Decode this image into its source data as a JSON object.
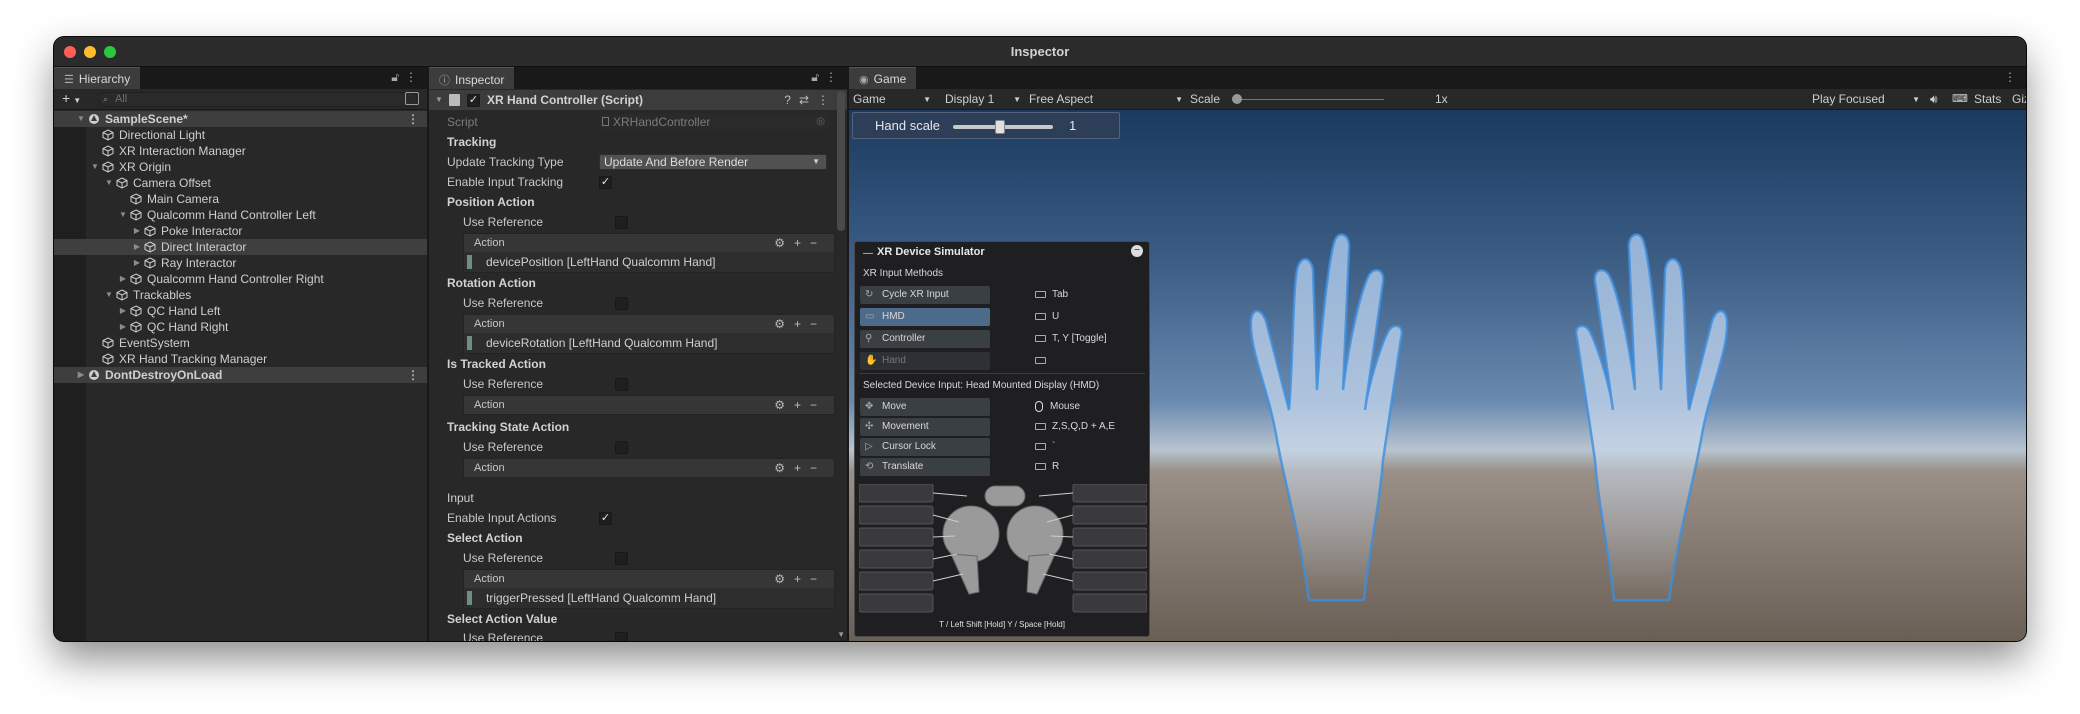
{
  "window": {
    "title": "Inspector"
  },
  "hierarchy": {
    "tab_label": "Hierarchy",
    "search_placeholder": "All",
    "items": [
      {
        "label": "SampleScene*",
        "depth": 0,
        "scene": true,
        "arrow": "down"
      },
      {
        "label": "Directional Light",
        "depth": 1
      },
      {
        "label": "XR Interaction Manager",
        "depth": 1
      },
      {
        "label": "XR Origin",
        "depth": 1,
        "arrow": "down"
      },
      {
        "label": "Camera Offset",
        "depth": 2,
        "arrow": "down"
      },
      {
        "label": "Main Camera",
        "depth": 3
      },
      {
        "label": "Qualcomm Hand Controller Left",
        "depth": 3,
        "arrow": "down"
      },
      {
        "label": "Poke Interactor",
        "depth": 4,
        "arrow": "right"
      },
      {
        "label": "Direct Interactor",
        "depth": 4,
        "arrow": "right",
        "selected": true
      },
      {
        "label": "Ray Interactor",
        "depth": 4,
        "arrow": "right"
      },
      {
        "label": "Qualcomm Hand Controller Right",
        "depth": 3,
        "arrow": "right"
      },
      {
        "label": "Trackables",
        "depth": 2,
        "arrow": "down"
      },
      {
        "label": "QC Hand Left",
        "depth": 3,
        "arrow": "right"
      },
      {
        "label": "QC Hand Right",
        "depth": 3,
        "arrow": "right"
      },
      {
        "label": "EventSystem",
        "depth": 1
      },
      {
        "label": "XR Hand Tracking Manager",
        "depth": 1
      },
      {
        "label": "DontDestroyOnLoad",
        "depth": 0,
        "scene": true,
        "arrow": "right"
      }
    ]
  },
  "inspector": {
    "tab_label": "Inspector",
    "component_title": "XR Hand Controller (Script)",
    "script_label": "Script",
    "script_value": "XRHandController",
    "tracking_header": "Tracking",
    "update_tracking_type_label": "Update Tracking Type",
    "update_tracking_type_value": "Update And Before Render",
    "enable_input_tracking_label": "Enable Input Tracking",
    "position_action_header": "Position Action",
    "use_reference_label": "Use Reference",
    "action_label": "Action",
    "position_action_value": "devicePosition [LeftHand Qualcomm Hand]",
    "rotation_action_header": "Rotation Action",
    "rotation_action_value": "deviceRotation [LeftHand Qualcomm Hand]",
    "is_tracked_action_header": "Is Tracked Action",
    "tracking_state_action_header": "Tracking State Action",
    "input_header": "Input",
    "enable_input_actions_label": "Enable Input Actions",
    "select_action_header": "Select Action",
    "select_action_value": "triggerPressed [LeftHand Qualcomm Hand]",
    "select_action_value_header": "Select Action Value",
    "last_partial_label": "Use Reference"
  },
  "game": {
    "tab_label": "Game",
    "mode": "Game",
    "display": "Display 1",
    "aspect": "Free Aspect",
    "scale_label": "Scale",
    "scale_value": "1x",
    "play_mode": "Play Focused",
    "stats_label": "Stats",
    "gizmos_label": "Gizmos",
    "hand_scale_label": "Hand scale",
    "hand_scale_value": "1"
  },
  "simulator": {
    "title": "XR Device Simulator",
    "methods_label": "XR Input Methods",
    "methods": [
      {
        "label": "Cycle XR Input",
        "key": "Tab",
        "state": "normal"
      },
      {
        "label": "HMD",
        "key": "U",
        "state": "active"
      },
      {
        "label": "Controller",
        "key": "T, Y [Toggle]",
        "state": "normal"
      },
      {
        "label": "Hand",
        "key": "",
        "state": "disabled"
      }
    ],
    "selected_label": "Selected Device Input:  Head Mounted Display (HMD)",
    "controls": [
      {
        "label": "Move",
        "key": "Mouse",
        "mouse": true
      },
      {
        "label": "Movement",
        "key": "Z,S,Q,D + A,E"
      },
      {
        "label": "Cursor Lock",
        "key": "`"
      },
      {
        "label": "Translate",
        "key": "R"
      }
    ],
    "controller_hint": "T / Left Shift [Hold]  Y / Space [Hold]"
  },
  "colors": {
    "accent": "#4c6a8a",
    "hand_glow": "#3d8fe0"
  }
}
